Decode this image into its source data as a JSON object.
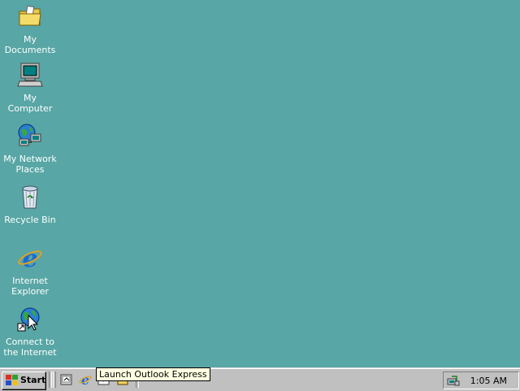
{
  "desktop": {
    "background": "#58a6a5",
    "icons": [
      {
        "name": "my-documents-icon",
        "label": "My Documents"
      },
      {
        "name": "my-computer-icon",
        "label": "My Computer"
      },
      {
        "name": "my-network-places-icon",
        "label_line1": "My Network",
        "label_line2": "Places"
      },
      {
        "name": "recycle-bin-icon",
        "label": "Recycle Bin"
      },
      {
        "name": "internet-explorer-icon",
        "label_line1": "Internet",
        "label_line2": "Explorer"
      },
      {
        "name": "connect-to-internet-icon",
        "label_line1": "Connect to",
        "label_line2": "the Internet"
      }
    ]
  },
  "taskbar": {
    "start_label": "Start",
    "quick_launch": [
      "show-desktop-icon",
      "internet-explorer-icon",
      "outlook-express-icon",
      "windows-media-player-icon"
    ],
    "tooltip": "Launch Outlook Express",
    "tray_icon": "network-connection-icon",
    "clock": "1:05 AM"
  }
}
